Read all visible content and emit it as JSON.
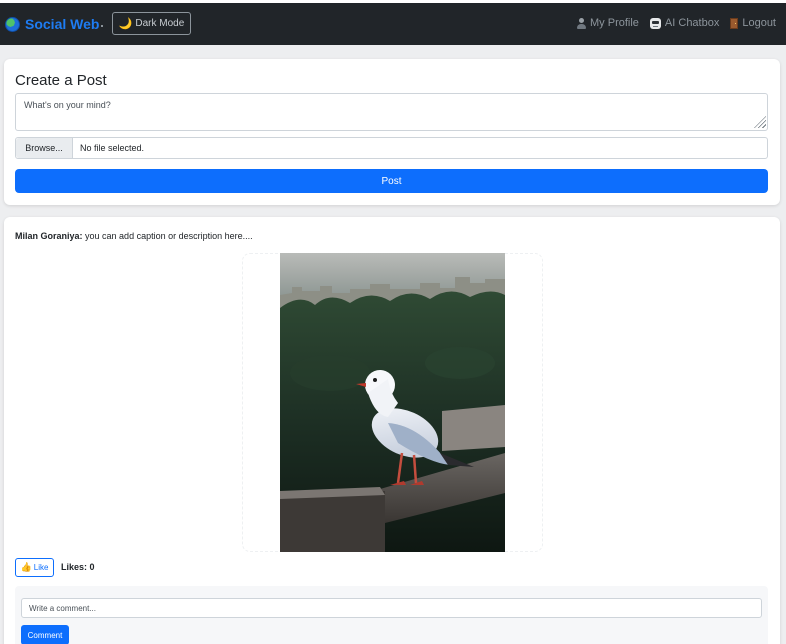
{
  "navbar": {
    "brand": "Social Web",
    "dark_mode_label": "Dark Mode",
    "links": [
      {
        "label": "My Profile",
        "icon": "person-icon"
      },
      {
        "label": "AI Chatbox",
        "icon": "robot-icon"
      },
      {
        "label": "Logout",
        "icon": "door-icon"
      }
    ]
  },
  "create_post": {
    "title": "Create a Post",
    "textarea_placeholder": "What's on your mind?",
    "browse_label": "Browse...",
    "file_status": "No file selected.",
    "post_label": "Post"
  },
  "post": {
    "author": "Milan Goraniya:",
    "caption": "you can add caption or description here....",
    "like_label": "Like",
    "likes_text": "Likes: 0",
    "comment_placeholder": "Write a comment...",
    "comment_button": "Comment"
  },
  "colors": {
    "navbar_bg": "#212529",
    "brand": "#1e7cf2",
    "primary": "#0d6efd"
  }
}
